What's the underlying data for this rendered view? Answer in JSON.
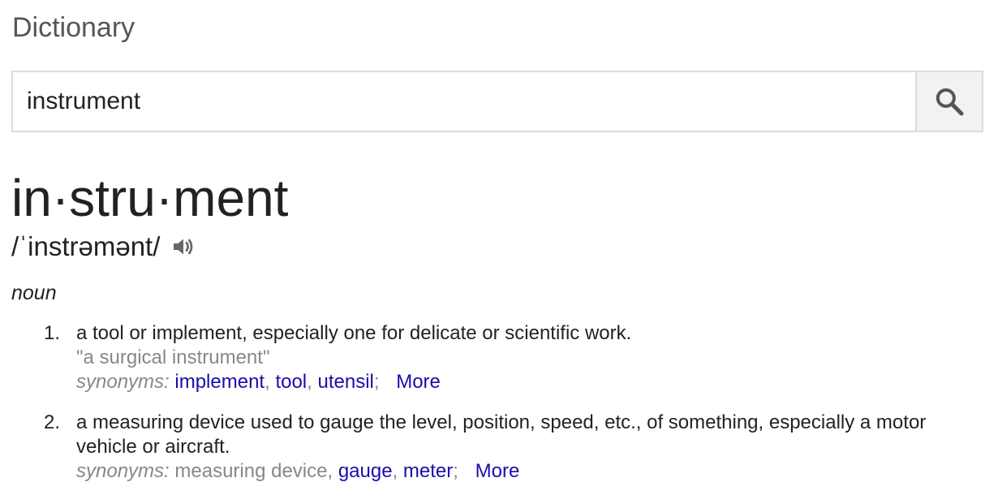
{
  "section_title": "Dictionary",
  "search": {
    "value": "instrument",
    "placeholder": "",
    "button_icon": "search-icon"
  },
  "entry": {
    "headword": "in·stru·ment",
    "pronunciation": "/ˈinstrəmənt/",
    "audio_icon": "speaker-icon",
    "part_of_speech": "noun",
    "definitions": [
      {
        "number": "1.",
        "text": "a tool or implement, especially one for delicate or scientific work.",
        "example": "\"a surgical instrument\"",
        "synonyms_label": "synonyms:",
        "synonyms": [
          {
            "text": "implement",
            "link": true,
            "sep": ","
          },
          {
            "text": "tool",
            "link": true,
            "sep": ","
          },
          {
            "text": "utensil",
            "link": true,
            "sep": ";"
          }
        ],
        "more_label": "More"
      },
      {
        "number": "2.",
        "text": "a measuring device used to gauge the level, position, speed, etc., of something, especially a motor vehicle or aircraft.",
        "example": "",
        "synonyms_label": "synonyms:",
        "synonyms": [
          {
            "text": "measuring device",
            "link": false,
            "sep": ","
          },
          {
            "text": "gauge",
            "link": true,
            "sep": ","
          },
          {
            "text": "meter",
            "link": true,
            "sep": ";"
          }
        ],
        "more_label": "More"
      }
    ]
  },
  "colors": {
    "link": "#1a0dab",
    "muted": "#878787",
    "text": "#222222"
  }
}
